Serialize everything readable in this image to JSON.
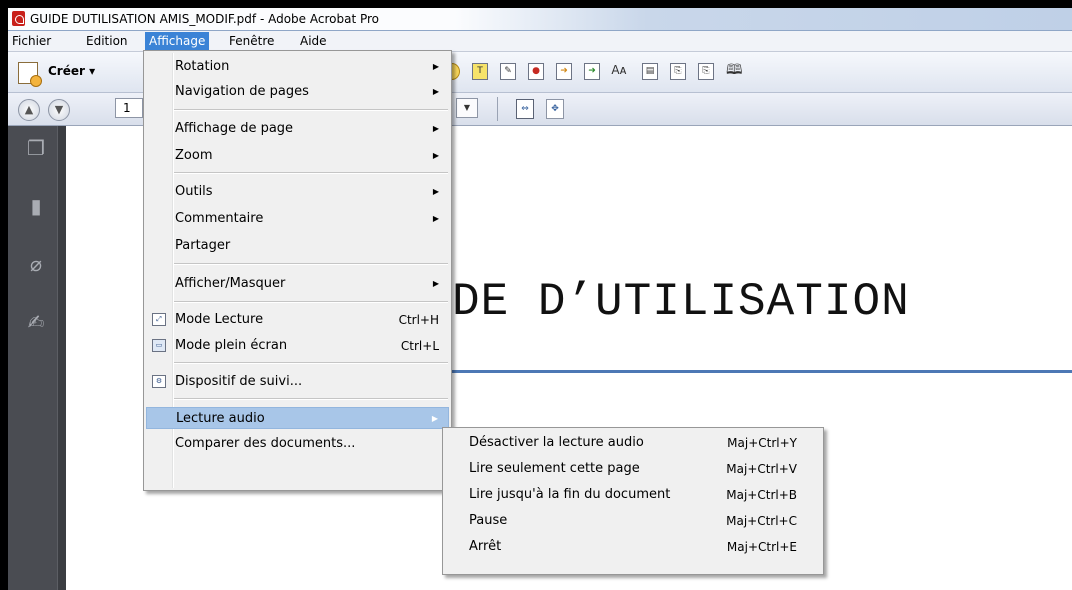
{
  "window": {
    "title": "GUIDE DUTILISATION AMIS_MODIF.pdf - Adobe Acrobat Pro"
  },
  "menubar": {
    "items": [
      "Fichier",
      "Edition",
      "Affichage",
      "Fenêtre",
      "Aide"
    ]
  },
  "toolbar": {
    "create_label": "Créer ▾",
    "page_number": "1",
    "icons": [
      "bubble-icon",
      "highlight-icon",
      "sign-icon",
      "secure-icon",
      "export-icon",
      "share-icon",
      "text-size-icon",
      "form-icon",
      "attach-icon",
      "note-icon",
      "read-icon"
    ]
  },
  "affichage_menu": {
    "items": [
      {
        "label": "Rotation",
        "submenu": true
      },
      {
        "label": "Navigation de pages",
        "submenu": true
      },
      {
        "label": "Affichage de page",
        "submenu": true
      },
      {
        "label": "Zoom",
        "submenu": true
      },
      {
        "label": "Outils",
        "submenu": true
      },
      {
        "label": "Commentaire",
        "submenu": true
      },
      {
        "label": "Partager",
        "submenu": false
      },
      {
        "label": "Afficher/Masquer",
        "submenu": true
      },
      {
        "label": "Mode Lecture",
        "shortcut": "Ctrl+H"
      },
      {
        "label": "Mode plein écran",
        "shortcut": "Ctrl+L"
      },
      {
        "label": "Dispositif de suivi..."
      },
      {
        "label": "Lecture audio",
        "submenu": true,
        "highlighted": true
      },
      {
        "label": "Comparer des documents..."
      }
    ]
  },
  "audio_submenu": {
    "items": [
      {
        "label": "Désactiver la lecture audio",
        "shortcut": "Maj+Ctrl+Y"
      },
      {
        "label": "Lire seulement cette page",
        "shortcut": "Maj+Ctrl+V"
      },
      {
        "label": "Lire jusqu'à la fin du document",
        "shortcut": "Maj+Ctrl+B"
      },
      {
        "label": "Pause",
        "shortcut": "Maj+Ctrl+C"
      },
      {
        "label": "Arrêt",
        "shortcut": "Maj+Ctrl+E"
      }
    ]
  },
  "document": {
    "title": "DE D’UTILISATION"
  },
  "colors": {
    "menu_highlight": "#a8c6e8",
    "menubar_active": "#3b83d6",
    "doc_rule": "#4d78b5"
  }
}
